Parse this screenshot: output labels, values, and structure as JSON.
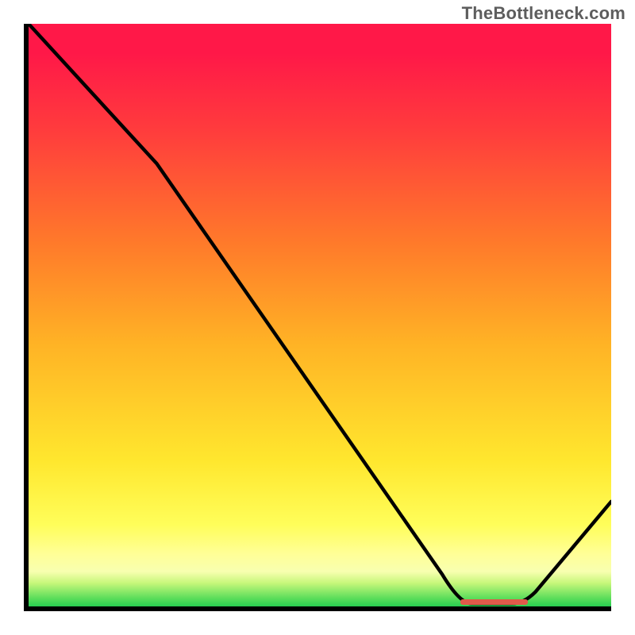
{
  "attribution": "TheBottleneck.com",
  "chart_data": {
    "type": "line",
    "title": "",
    "xlabel": "",
    "ylabel": "",
    "xlim": [
      0,
      100
    ],
    "ylim": [
      0,
      100
    ],
    "x": [
      0,
      22,
      74,
      85,
      100
    ],
    "values": [
      100,
      76,
      0.5,
      0.5,
      18
    ],
    "note": "Values are read off the single unlabeled curve as percentage of plot height; gradient background runs red (top) → green (bottom).",
    "trough_span_pct": [
      73.5,
      85
    ],
    "colors": {
      "top": "#ff1848",
      "mid": "#ffe72e",
      "bottom": "#27ce51",
      "curve": "#000000",
      "trough_marker": "#e05a4a"
    }
  }
}
